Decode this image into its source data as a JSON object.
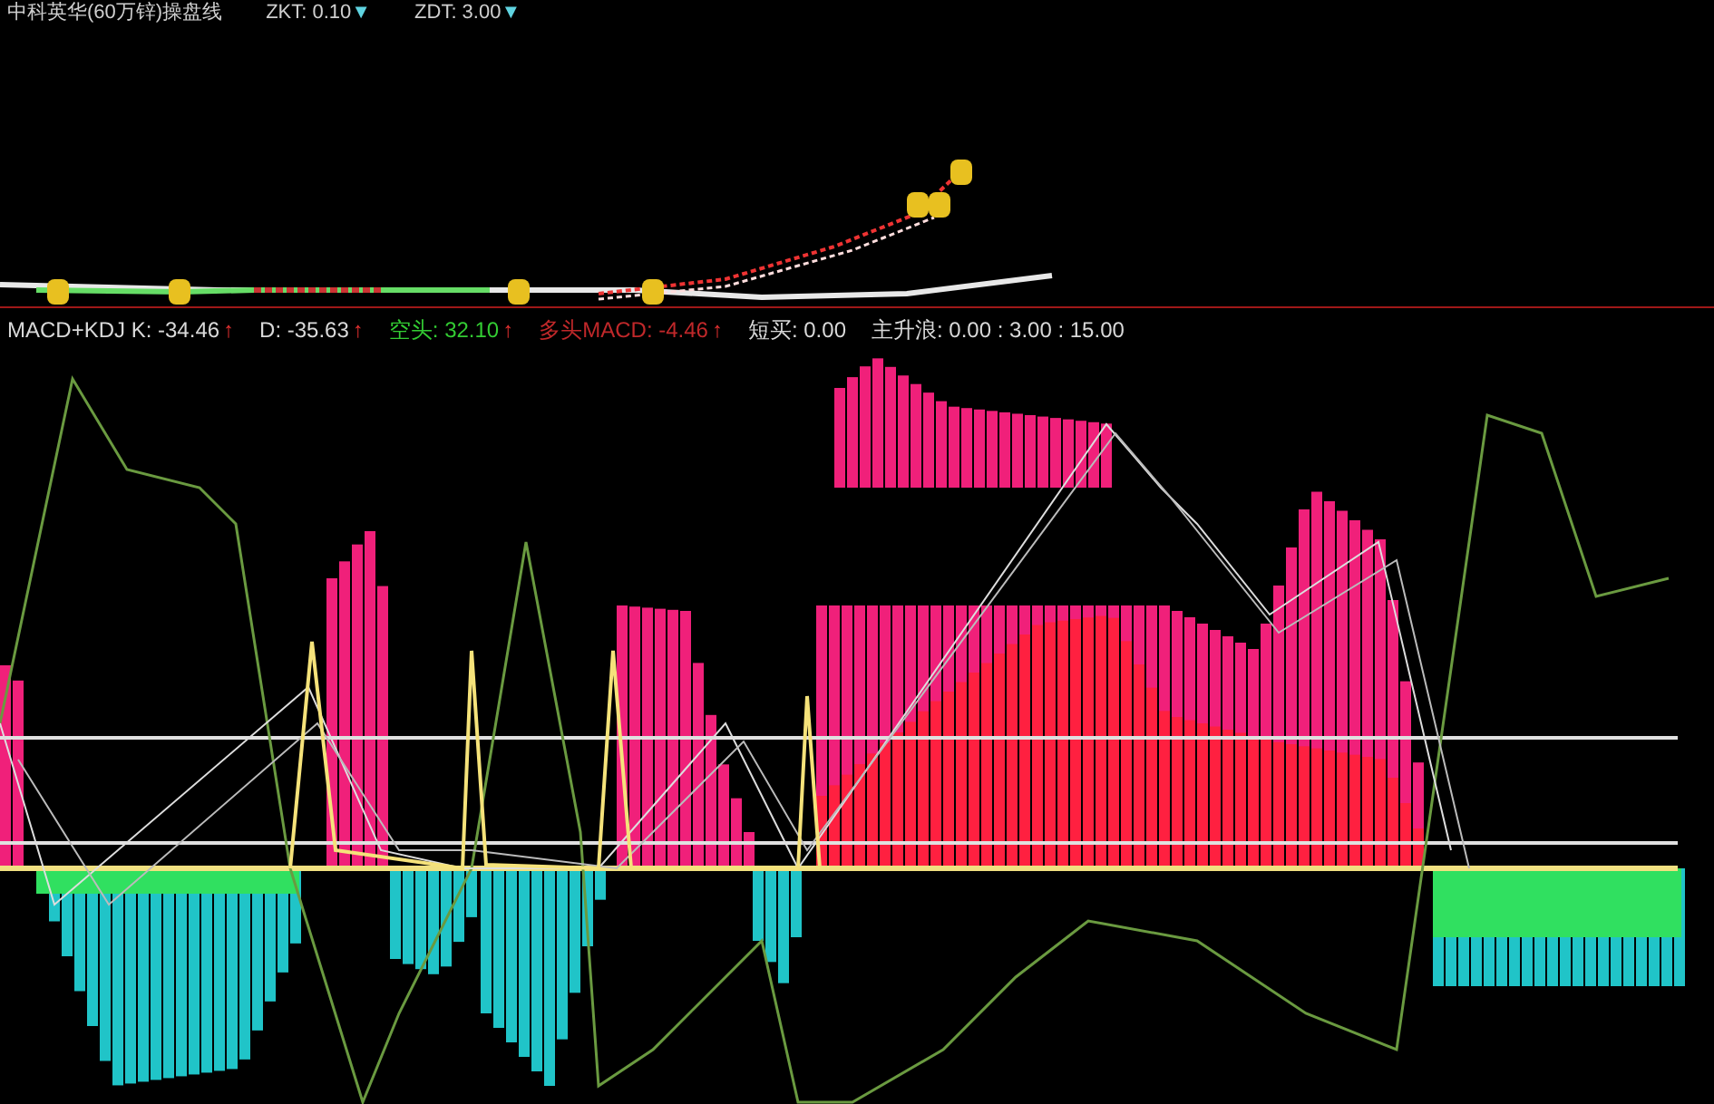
{
  "header": {
    "title": "中科英华(60万锌)操盘线",
    "readouts": [
      {
        "text": "ZKT: 0.10",
        "arrow": "▼"
      },
      {
        "text": "ZDT: 3.00",
        "arrow": "▼"
      }
    ]
  },
  "legend": [
    {
      "text": "MACD+KDJ K: -34.46",
      "arrow": "↑",
      "color": "#d9d9d9"
    },
    {
      "text": "D: -35.63",
      "arrow": "↑",
      "color": "#d9d9d9"
    },
    {
      "text": "空头: 32.10",
      "arrow": "↑",
      "color": "#33cc33"
    },
    {
      "text": "多头MACD: -4.46",
      "arrow": "↑",
      "color": "#c0282a"
    },
    {
      "text": "短买: 0.00",
      "color": "#d9d9d9"
    },
    {
      "text": "主升浪: 0.00 : 3.00 : 15.00",
      "color": "#d9d9d9"
    }
  ]
}
